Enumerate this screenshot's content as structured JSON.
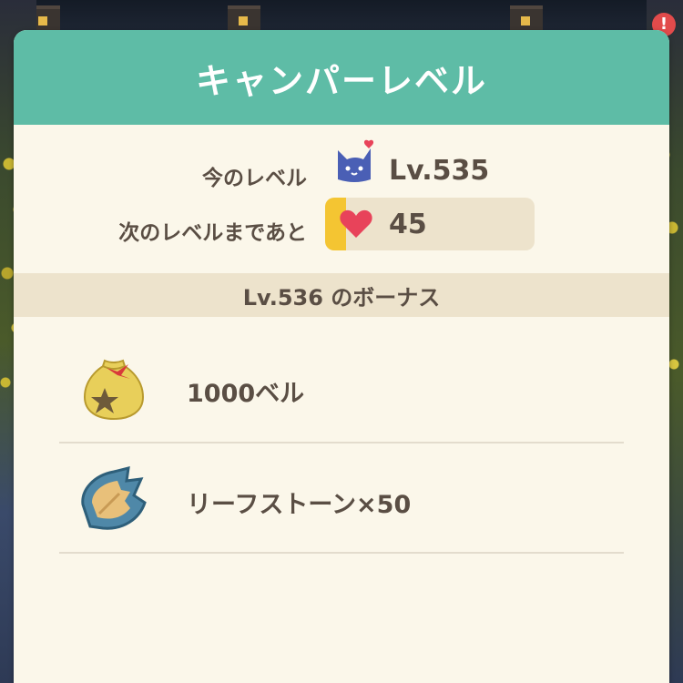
{
  "panel": {
    "title": "キャンパーレベル"
  },
  "status": {
    "current_level_label": "今のレベル",
    "current_level_value": "Lv.535",
    "next_level_label": "次のレベルまであと",
    "remaining_value": "45",
    "progress_fraction": 0.1
  },
  "bonus": {
    "title": "Lv.536 のボーナス",
    "items": [
      {
        "label": "1000ベル",
        "icon": "bell-bag-icon"
      },
      {
        "label": "リーフストーン×50",
        "icon": "leaf-stone-icon"
      }
    ]
  },
  "icons": {
    "level": "cat-heart-icon",
    "progress": "heart-icon",
    "alert": "alert-badge-icon"
  },
  "alert_badge": "!",
  "colors": {
    "header": "#5ebca6",
    "panel_bg": "#fbf7ea",
    "band_bg": "#ede3cc",
    "text": "#5a4e44",
    "progress_fill": "#f4c532",
    "heart": "#e8435a",
    "cat": "#4a5fb5"
  }
}
